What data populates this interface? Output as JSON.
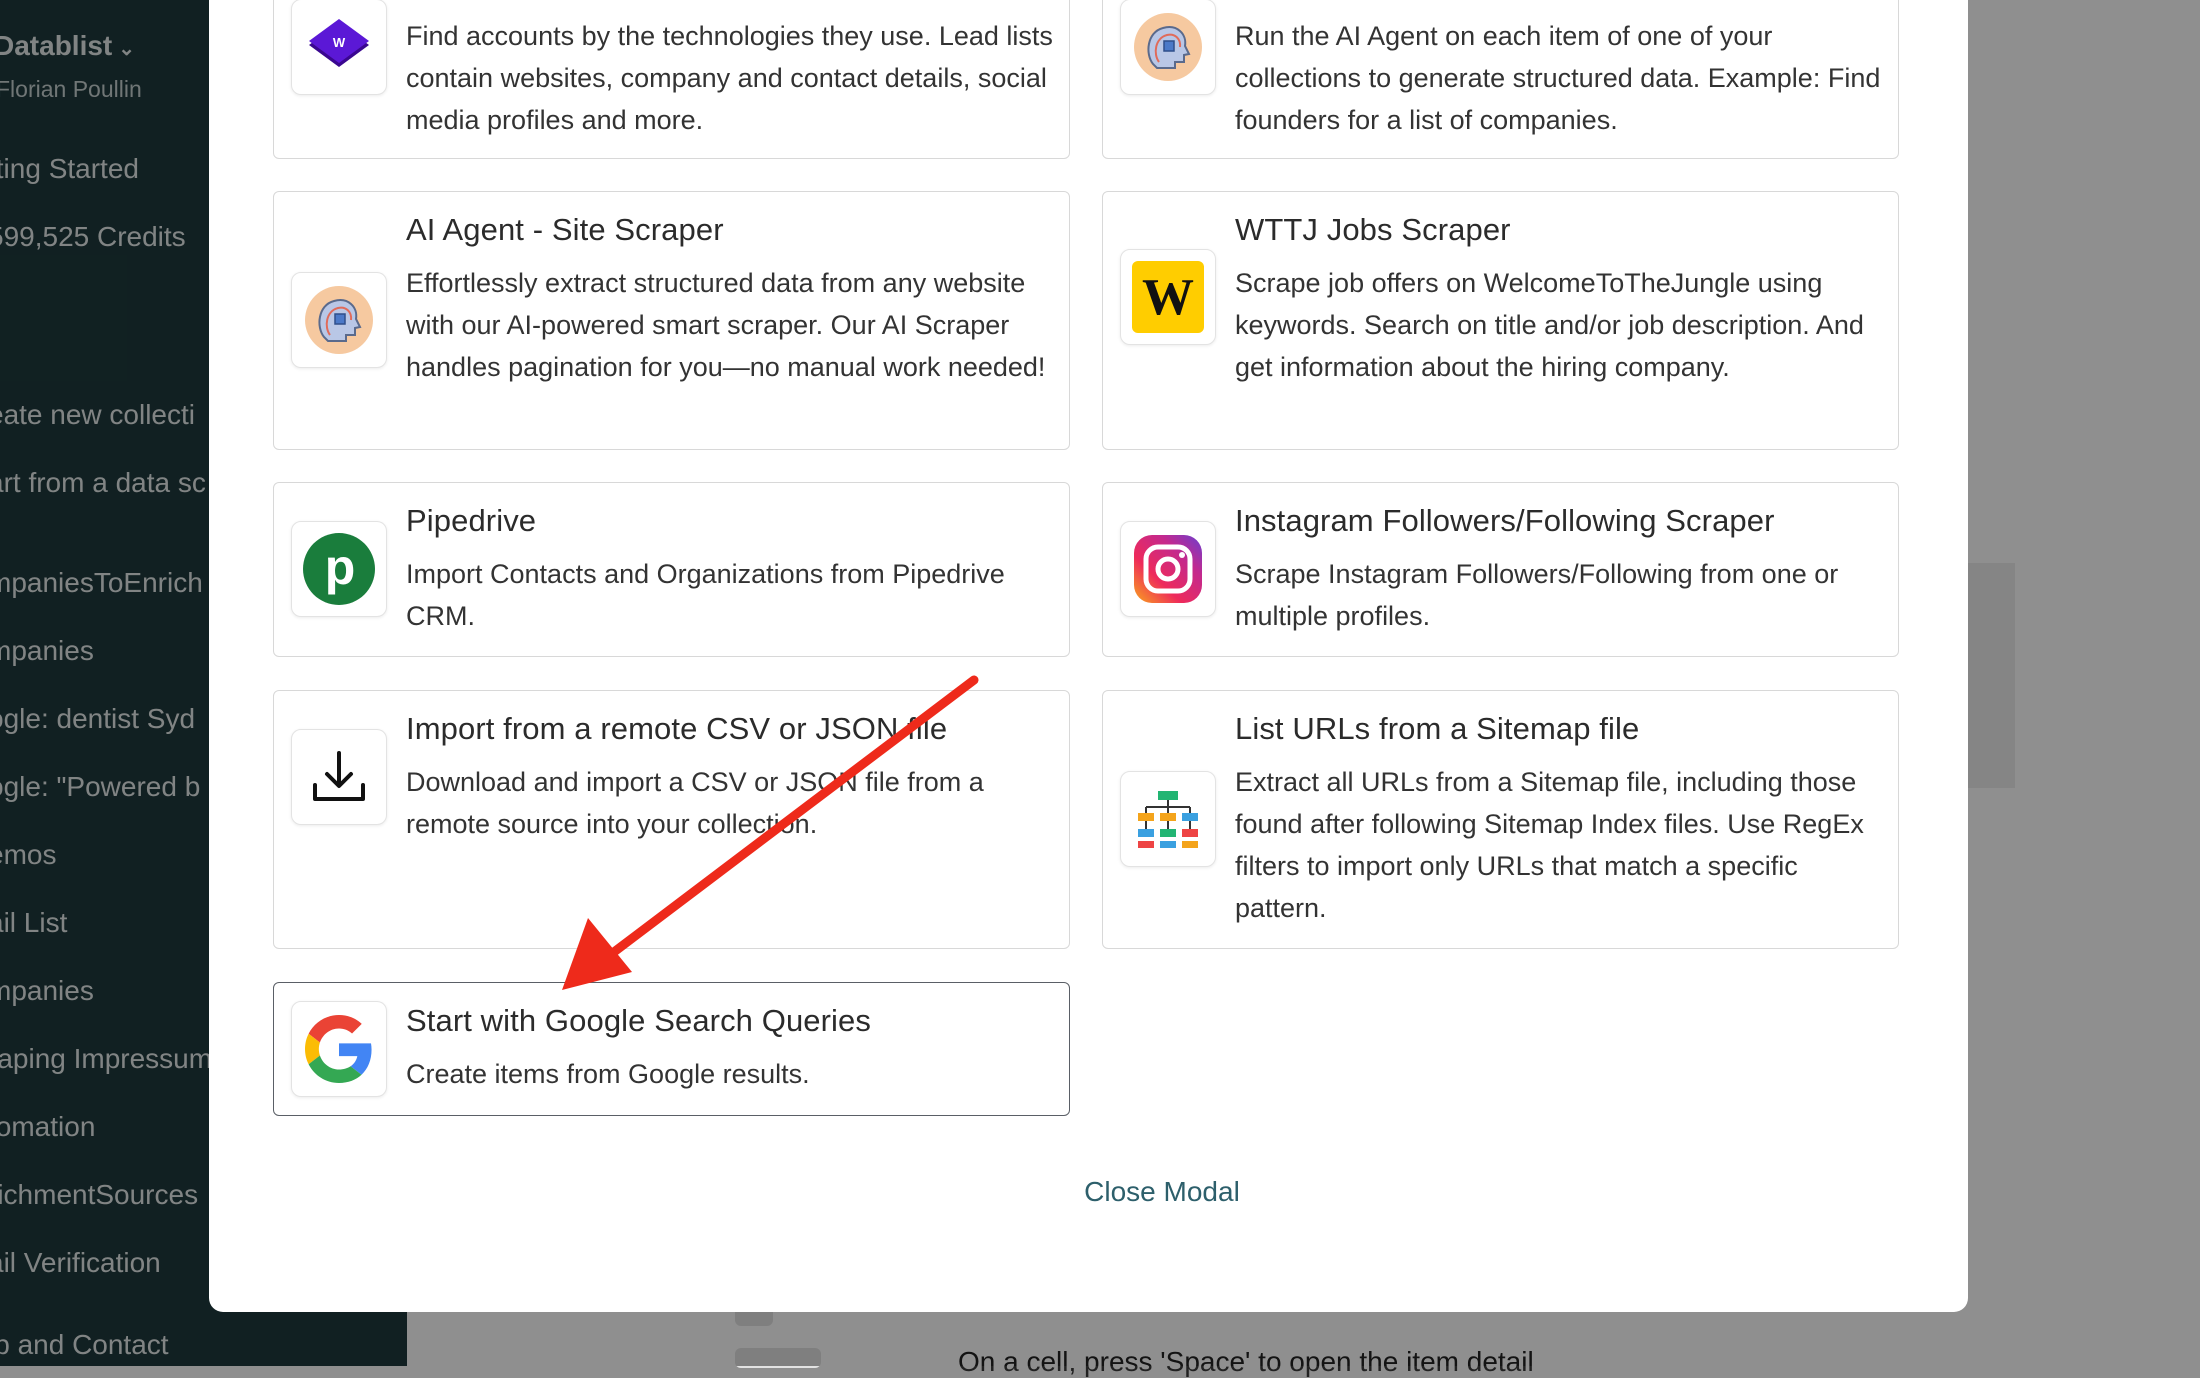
{
  "sidebar": {
    "workspace": "Datablist",
    "user": "Florian Poullin",
    "items": [
      "tting Started",
      "599,525 Credits",
      "eate new collecti",
      "art from a data sc",
      "mpaniesToEnrich",
      "mpanies",
      "ogle: dentist Syd",
      "ogle: \"Powered b",
      "emos",
      "ail List",
      "mpanies",
      "raping Impressum",
      "tomation",
      "richmentSources",
      "ail Verification",
      "lp and Contact"
    ]
  },
  "background": {
    "hint": "On a cell, press 'Space' to open the item detail"
  },
  "modal": {
    "cards": [
      {
        "title": "",
        "desc": "Find accounts by the technologies they use. Lead lists contain websites, company and contact details, social media profiles and more.",
        "icon": "wappalyzer-icon"
      },
      {
        "title": "",
        "desc": "Run the AI Agent on each item of one of your collections to generate structured data. Example: Find founders for a list of companies.",
        "icon": "ai-agent-icon"
      },
      {
        "title": "AI Agent - Site Scraper",
        "desc": "Effortlessly extract structured data from any website with our AI-powered smart scraper. Our AI Scraper handles pagination for you—no manual work needed!",
        "icon": "ai-agent-icon"
      },
      {
        "title": "WTTJ Jobs Scraper",
        "desc": "Scrape job offers on WelcomeToTheJungle using keywords. Search on title and/or job description. And get information about the hiring company.",
        "icon": "wttj-icon"
      },
      {
        "title": "Pipedrive",
        "desc": "Import Contacts and Organizations from Pipedrive CRM.",
        "icon": "pipedrive-icon"
      },
      {
        "title": "Instagram Followers/Following Scraper",
        "desc": "Scrape Instagram Followers/Following from one or multiple profiles.",
        "icon": "instagram-icon"
      },
      {
        "title": "Import from a remote CSV or JSON file",
        "desc": "Download and import a CSV or JSON file from a remote source into your collection.",
        "icon": "download-icon"
      },
      {
        "title": "List URLs from a Sitemap file",
        "desc": "Extract all URLs from a Sitemap file, including those found after following Sitemap Index files. Use RegEx filters to import only URLs that match a specific pattern.",
        "icon": "sitemap-icon"
      },
      {
        "title": "Start with Google Search Queries",
        "desc": "Create items from Google results.",
        "icon": "google-icon"
      }
    ],
    "close_label": "Close Modal"
  },
  "colors": {
    "sidebar_bg": "#1f3a3d",
    "link": "#2d5f6b",
    "arrow": "#ee2a1b",
    "pipedrive": "#1a7d3c",
    "wttj": "#ffcd00",
    "wappalyzer": "#4608ad"
  }
}
